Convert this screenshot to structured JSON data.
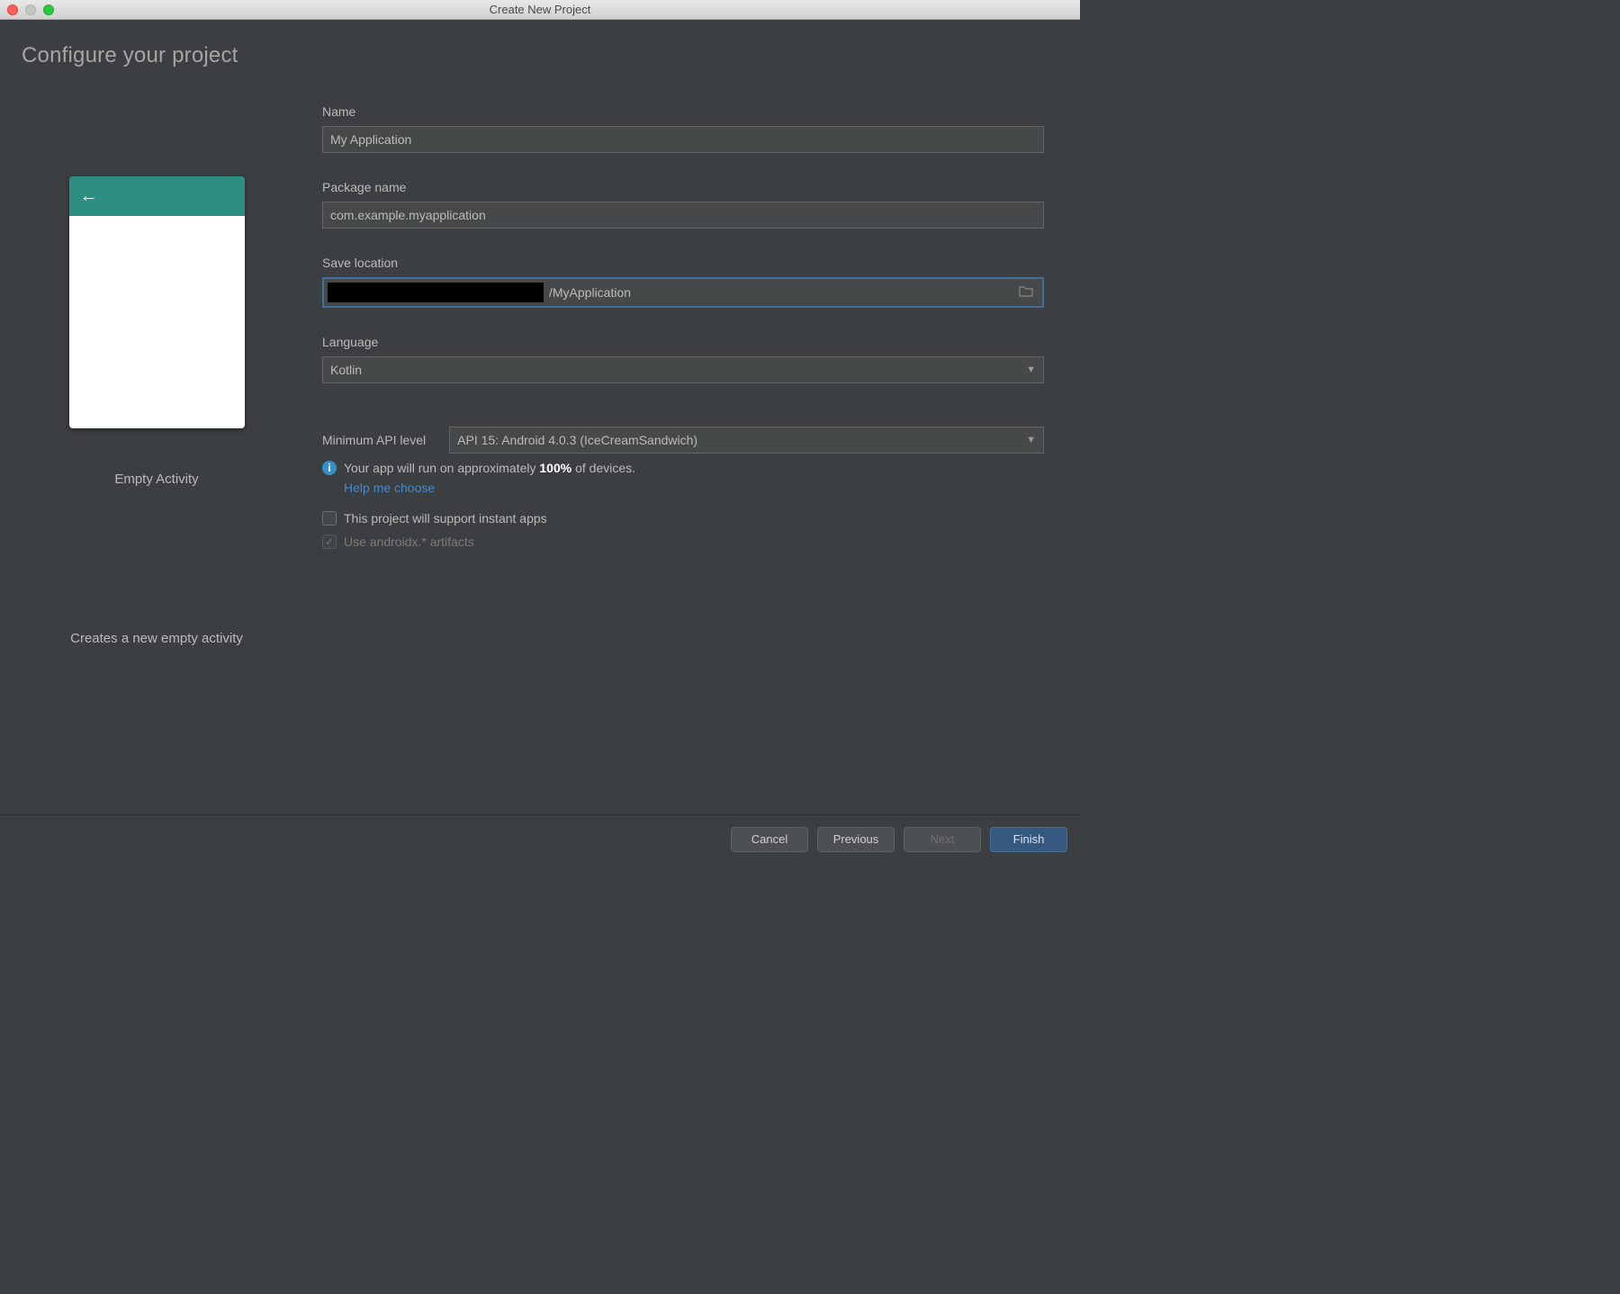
{
  "window": {
    "title": "Create New Project"
  },
  "heading": "Configure your project",
  "preview": {
    "template_name": "Empty Activity",
    "description": "Creates a new empty activity"
  },
  "form": {
    "name": {
      "label": "Name",
      "value": "My Application"
    },
    "package": {
      "label": "Package name",
      "value": "com.example.myapplication"
    },
    "location": {
      "label": "Save location",
      "visible_suffix": "/MyApplication"
    },
    "language": {
      "label": "Language",
      "value": "Kotlin"
    },
    "api": {
      "label": "Minimum API level",
      "value": "API 15: Android 4.0.3 (IceCreamSandwich)",
      "info_prefix": "Your app will run on approximately ",
      "info_pct": "100%",
      "info_suffix": " of devices.",
      "help_link": "Help me choose"
    },
    "instant_apps": {
      "label": "This project will support instant apps",
      "checked": false
    },
    "androidx": {
      "label": "Use androidx.* artifacts",
      "checked": true,
      "disabled": true
    }
  },
  "buttons": {
    "cancel": "Cancel",
    "previous": "Previous",
    "next": "Next",
    "finish": "Finish"
  }
}
